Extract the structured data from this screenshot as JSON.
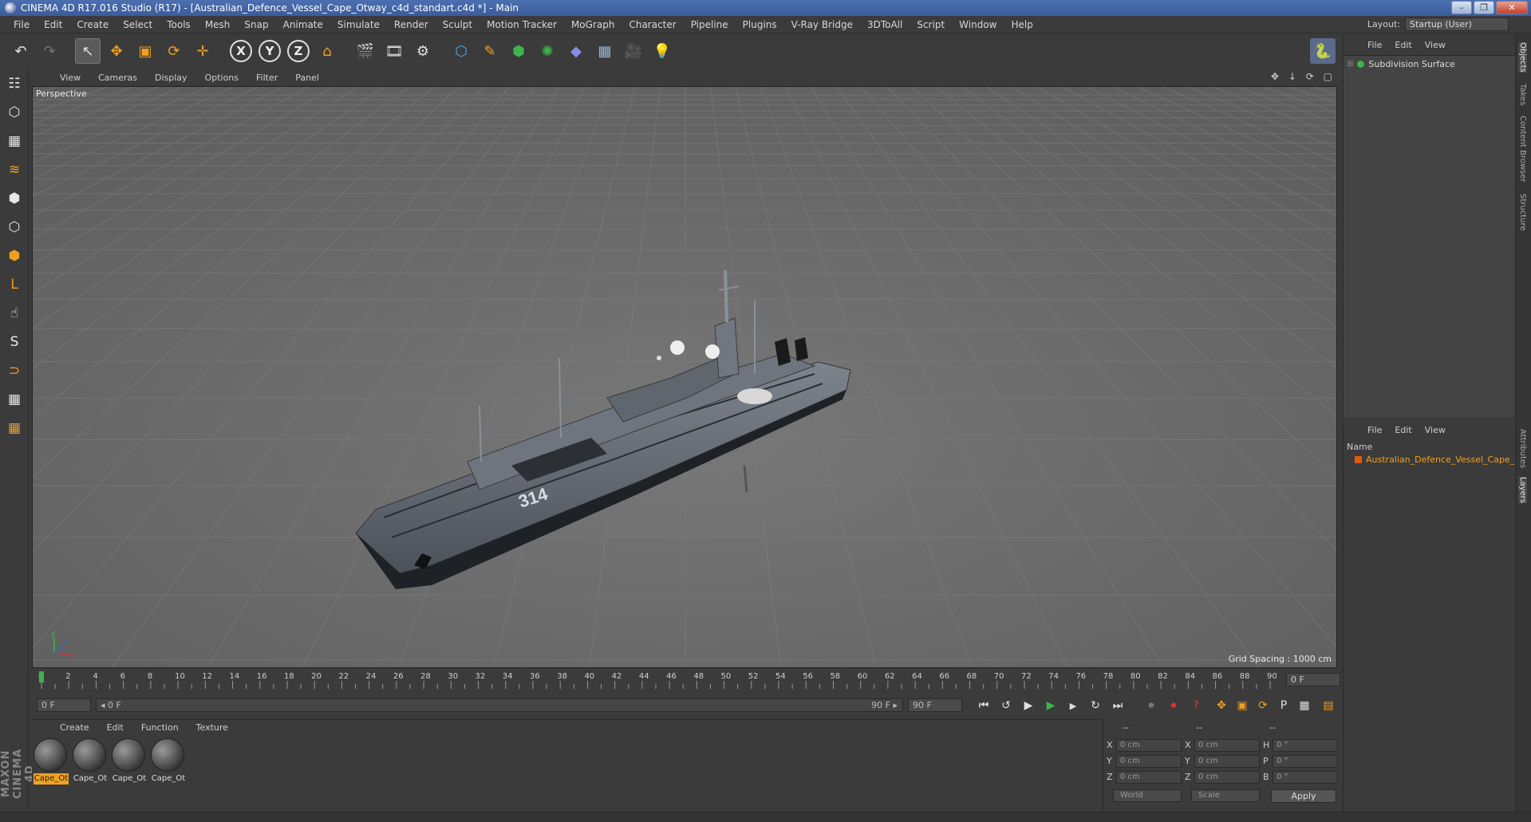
{
  "titlebar": {
    "title": "CINEMA 4D R17.016 Studio (R17) - [Australian_Defence_Vessel_Cape_Otway_c4d_standart.c4d *] - Main",
    "minimize": "–",
    "maximize": "❐",
    "close": "✕"
  },
  "menubar": {
    "items": [
      "File",
      "Edit",
      "Create",
      "Select",
      "Tools",
      "Mesh",
      "Snap",
      "Animate",
      "Simulate",
      "Render",
      "Sculpt",
      "Motion Tracker",
      "MoGraph",
      "Character",
      "Pipeline",
      "Plugins",
      "V-Ray Bridge",
      "3DToAll",
      "Script",
      "Window",
      "Help"
    ],
    "layout_label": "Layout:",
    "layout_value": "Startup (User)"
  },
  "toolbar": {
    "undo": "↶",
    "redo": "↷",
    "select": "↖",
    "move": "✥",
    "scale": "▣",
    "rotate": "⟳",
    "transform": "✛",
    "axis_x": "X",
    "axis_y": "Y",
    "axis_z": "Z",
    "coord_system": "⌂",
    "render_view": "🎬",
    "render": "🎞",
    "render_settings": "⚙",
    "cube": "⬡",
    "spline": "✎",
    "nurbs": "⬢",
    "array": "✺",
    "deformer": "◆",
    "floor": "▦",
    "camera": "🎥",
    "light": "💡",
    "python": "🐍"
  },
  "leftbar": {
    "icons": [
      "☷",
      "⬡",
      "▦",
      "≋",
      "⬢",
      "⬡",
      "⬢",
      "L",
      "☝",
      "S",
      "⊃",
      "▦",
      "▦"
    ]
  },
  "viewport": {
    "menu": [
      "View",
      "Cameras",
      "Display",
      "Options",
      "Filter",
      "Panel"
    ],
    "nav_icons": "✥ ↓ ⟳ ▢",
    "label": "Perspective",
    "grid_spacing": "Grid Spacing : 1000 cm",
    "hull_number": "314",
    "axis_y": "y",
    "axis_x": "x",
    "axis_z": "z"
  },
  "timeline": {
    "ticks": [
      "0",
      "2",
      "4",
      "6",
      "8",
      "10",
      "12",
      "14",
      "16",
      "18",
      "20",
      "22",
      "24",
      "26",
      "28",
      "30",
      "32",
      "34",
      "36",
      "38",
      "40",
      "42",
      "44",
      "46",
      "48",
      "50",
      "52",
      "54",
      "56",
      "58",
      "60",
      "62",
      "64",
      "66",
      "68",
      "70",
      "72",
      "74",
      "76",
      "78",
      "80",
      "82",
      "84",
      "86",
      "88",
      "90"
    ],
    "current_frame": "0 F"
  },
  "transport": {
    "start_field": "0 F",
    "range_start": "◂ 0 F",
    "range_end": "90 F ▸",
    "end_field": "90 F",
    "go_start": "⏮",
    "prev_key": "↺",
    "prev_frame": "◀",
    "play": "▶",
    "next_frame": "▶",
    "next_key": "↻",
    "go_end": "⏭",
    "record": "⏺",
    "auto_key": "⏺",
    "keyframe_sel": "?",
    "key_pos": "✥",
    "key_scale": "▣",
    "key_rot": "⟳",
    "key_param": "P",
    "key_pla": "▦",
    "timeline_btn": "▤"
  },
  "materials": {
    "menu": [
      "Create",
      "Edit",
      "Function",
      "Texture"
    ],
    "items": [
      "Cape_Ot",
      "Cape_Ot",
      "Cape_Ot",
      "Cape_Ot"
    ]
  },
  "coordinates": {
    "header_left": "--",
    "header_mid": "--",
    "header_right": "--",
    "rows": [
      {
        "a": "X",
        "av": "0 cm",
        "b": "X",
        "bv": "0 cm",
        "c": "H",
        "cv": "0 °"
      },
      {
        "a": "Y",
        "av": "0 cm",
        "b": "Y",
        "bv": "0 cm",
        "c": "P",
        "cv": "0 °"
      },
      {
        "a": "Z",
        "av": "0 cm",
        "b": "Z",
        "bv": "0 cm",
        "c": "B",
        "cv": "0 °"
      }
    ],
    "space": "World",
    "mode": "Scale",
    "apply": "Apply"
  },
  "objects_panel": {
    "menu": [
      "File",
      "Edit",
      "View"
    ],
    "object_name": "Subdivision Surface"
  },
  "layers_panel": {
    "menu": [
      "File",
      "Edit",
      "View"
    ],
    "name_header": "Name",
    "layer_name": "Australian_Defence_Vessel_Cape_"
  },
  "vtabs": [
    "Objects",
    "Takes",
    "Content Browser",
    "Structure",
    "Attributes",
    "Layers"
  ],
  "colors": {
    "accent": "#f0a020",
    "viewport_bg": "#6b6b6b",
    "panel_bg": "#3b3b3b",
    "titlebar": "#3b5c9a"
  }
}
